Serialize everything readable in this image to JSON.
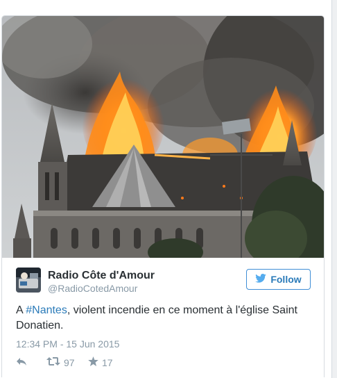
{
  "tweet": {
    "display_name": "Radio Côte d'Amour",
    "handle": "@RadioCotedAmour",
    "follow_label": "Follow",
    "text_before": "A ",
    "hashtag": "#Nantes",
    "text_after": ", violent incendie en ce moment à l'église Saint Donatien.",
    "timestamp": "12:34 PM - 15 Jun 2015",
    "retweets": "97",
    "favorites": "17"
  },
  "colors": {
    "link": "#2b7bb9",
    "muted": "#8899a6",
    "text": "#292f33"
  },
  "icons": {
    "follow": "twitter-bird-icon",
    "reply": "reply-icon",
    "retweet": "retweet-icon",
    "favorite": "star-icon"
  }
}
